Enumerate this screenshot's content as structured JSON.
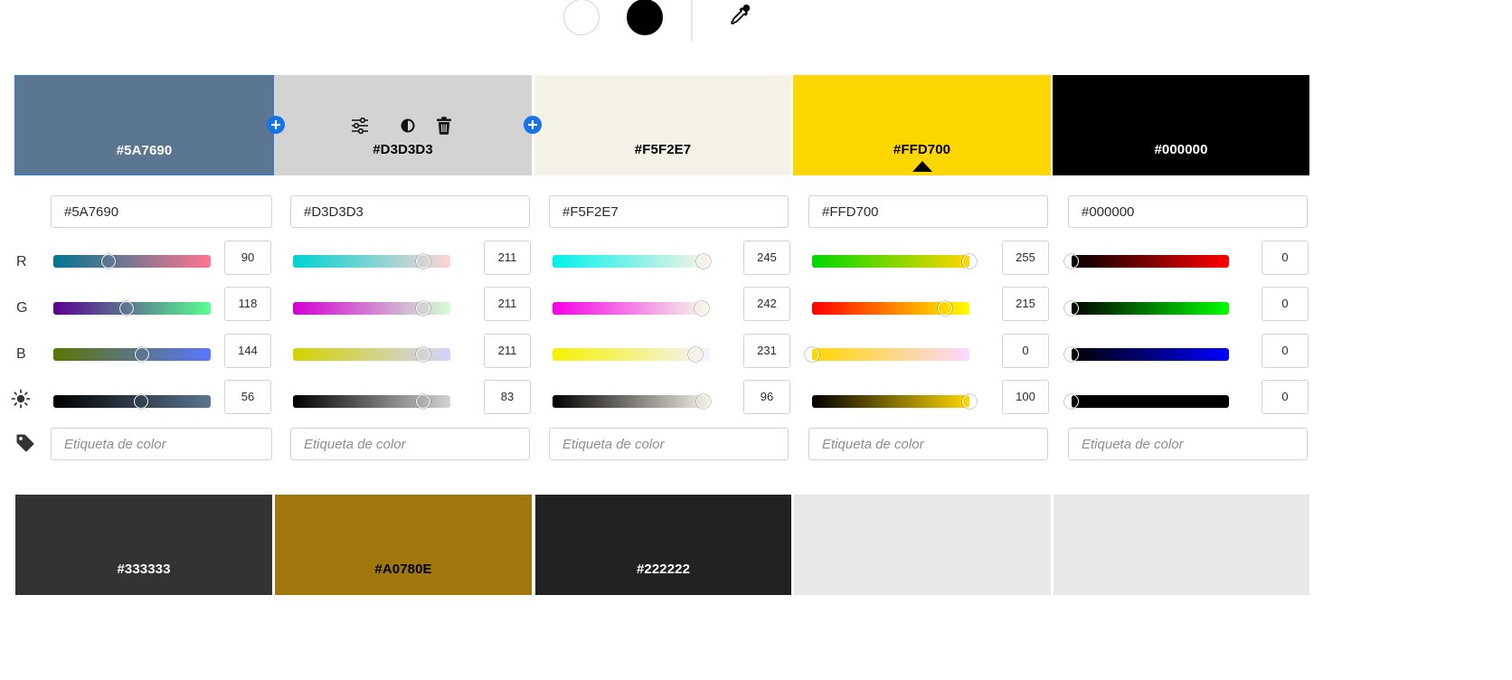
{
  "toolbar": {
    "white_circle": "white-color-button",
    "black_circle": "black-color-button",
    "eyedropper_icon": "eyedropper-icon"
  },
  "row_labels": {
    "r": "R",
    "g": "G",
    "b": "B",
    "brightness_icon": "sun-icon",
    "label_icon": "tag-icon"
  },
  "label_placeholder": "Etiqueta de color",
  "swatches": [
    {
      "hex": "#5A7690",
      "color": "#5A7690",
      "text_color": "#ffffff",
      "r": 90,
      "g": 118,
      "b": 144,
      "brightness": 56
    },
    {
      "hex": "#D3D3D3",
      "color": "#D3D3D3",
      "text_color": "#000000",
      "r": 211,
      "g": 211,
      "b": 211,
      "brightness": 83
    },
    {
      "hex": "#F5F2E7",
      "color": "#F5F2E7",
      "text_color": "#000000",
      "r": 245,
      "g": 242,
      "b": 231,
      "brightness": 96
    },
    {
      "hex": "#FFD700",
      "color": "#FFD700",
      "text_color": "#000000",
      "r": 255,
      "g": 215,
      "b": 0,
      "brightness": 100
    },
    {
      "hex": "#000000",
      "color": "#000000",
      "text_color": "#ffffff",
      "r": 0,
      "g": 0,
      "b": 0,
      "brightness": 0
    }
  ],
  "fields": [
    {
      "hex_value": "#5A7690",
      "r": "90",
      "g": "118",
      "b": "144",
      "brightness": "56"
    },
    {
      "hex_value": "#D3D3D3",
      "r": "211",
      "g": "211",
      "b": "211",
      "brightness": "83"
    },
    {
      "hex_value": "#F5F2E7",
      "r": "245",
      "g": "242",
      "b": "231",
      "brightness": "96"
    },
    {
      "hex_value": "#FFD700",
      "r": "255",
      "g": "215",
      "b": "0",
      "brightness": "100"
    },
    {
      "hex_value": "#000000",
      "r": "0",
      "g": "0",
      "b": "0",
      "brightness": "0"
    }
  ],
  "tools": {
    "adjust_icon": "sliders-icon",
    "contrast_icon": "contrast-icon",
    "delete_icon": "trash-icon",
    "add_icon": "add-color-icon"
  },
  "accent_color": "#1473E6",
  "selection_border_color": "#2D7BE0",
  "extra_swatches": [
    {
      "hex": "#333333",
      "color": "#333333",
      "text_color": "#ffffff"
    },
    {
      "hex": "#A0780E",
      "color": "#A0780E",
      "text_color": "#000000"
    },
    {
      "hex": "#222222",
      "color": "#222222",
      "text_color": "#ffffff"
    },
    {
      "hex": "",
      "color": "#E8E8E8",
      "text_color": "#000000"
    },
    {
      "hex": "",
      "color": "#E8E8E8",
      "text_color": "#000000"
    }
  ]
}
